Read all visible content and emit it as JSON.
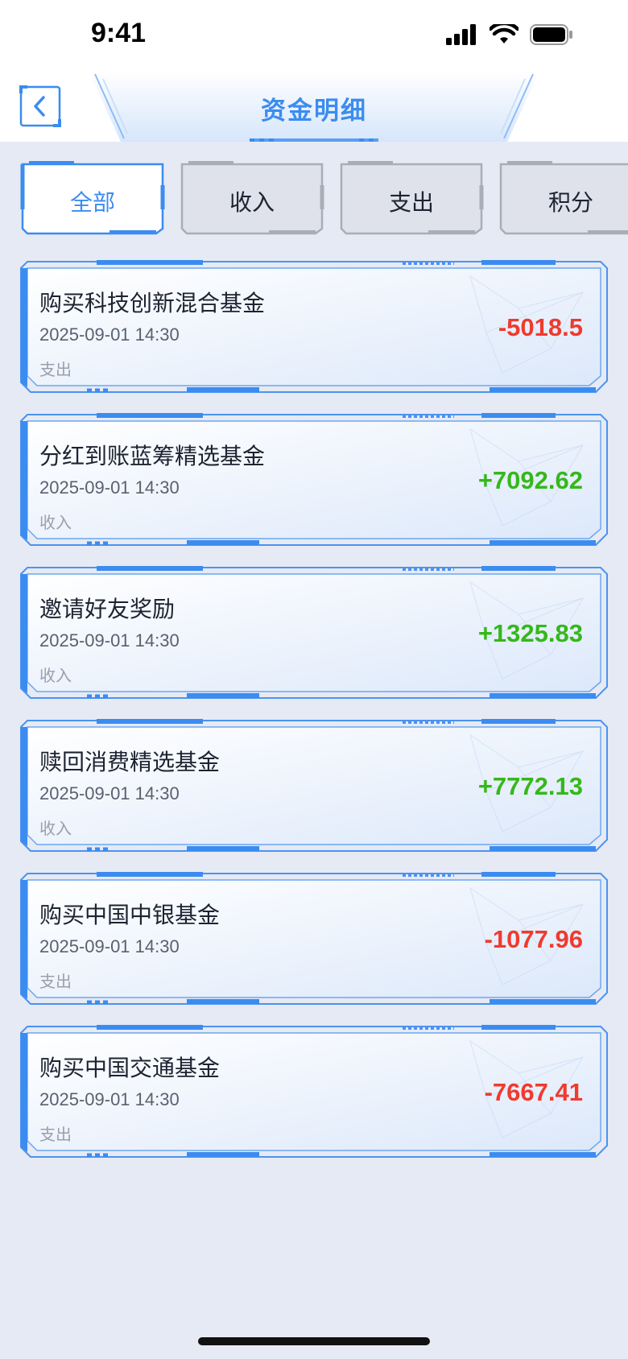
{
  "status_bar": {
    "time": "9:41"
  },
  "header": {
    "title": "资金明细",
    "accent": "#3b8cf0"
  },
  "filter_tabs": [
    {
      "label": "全部",
      "active": true
    },
    {
      "label": "收入",
      "active": false
    },
    {
      "label": "支出",
      "active": false
    },
    {
      "label": "积分",
      "active": false
    }
  ],
  "transactions": [
    {
      "title": "购买科技创新混合基金",
      "time": "2025-09-01 14:30",
      "type": "支出",
      "amount": "-5018.5",
      "direction": "neg"
    },
    {
      "title": "分红到账蓝筹精选基金",
      "time": "2025-09-01 14:30",
      "type": "收入",
      "amount": "+7092.62",
      "direction": "pos"
    },
    {
      "title": "邀请好友奖励",
      "time": "2025-09-01 14:30",
      "type": "收入",
      "amount": "+1325.83",
      "direction": "pos"
    },
    {
      "title": "赎回消费精选基金",
      "time": "2025-09-01 14:30",
      "type": "收入",
      "amount": "+7772.13",
      "direction": "pos"
    },
    {
      "title": "购买中国中银基金",
      "time": "2025-09-01 14:30",
      "type": "支出",
      "amount": "-1077.96",
      "direction": "neg"
    },
    {
      "title": "购买中国交通基金",
      "time": "2025-09-01 14:30",
      "type": "支出",
      "amount": "-7667.41",
      "direction": "neg"
    }
  ],
  "colors": {
    "expense": "#f03a2e",
    "income": "#35b81a",
    "background": "#e6eaf4"
  }
}
